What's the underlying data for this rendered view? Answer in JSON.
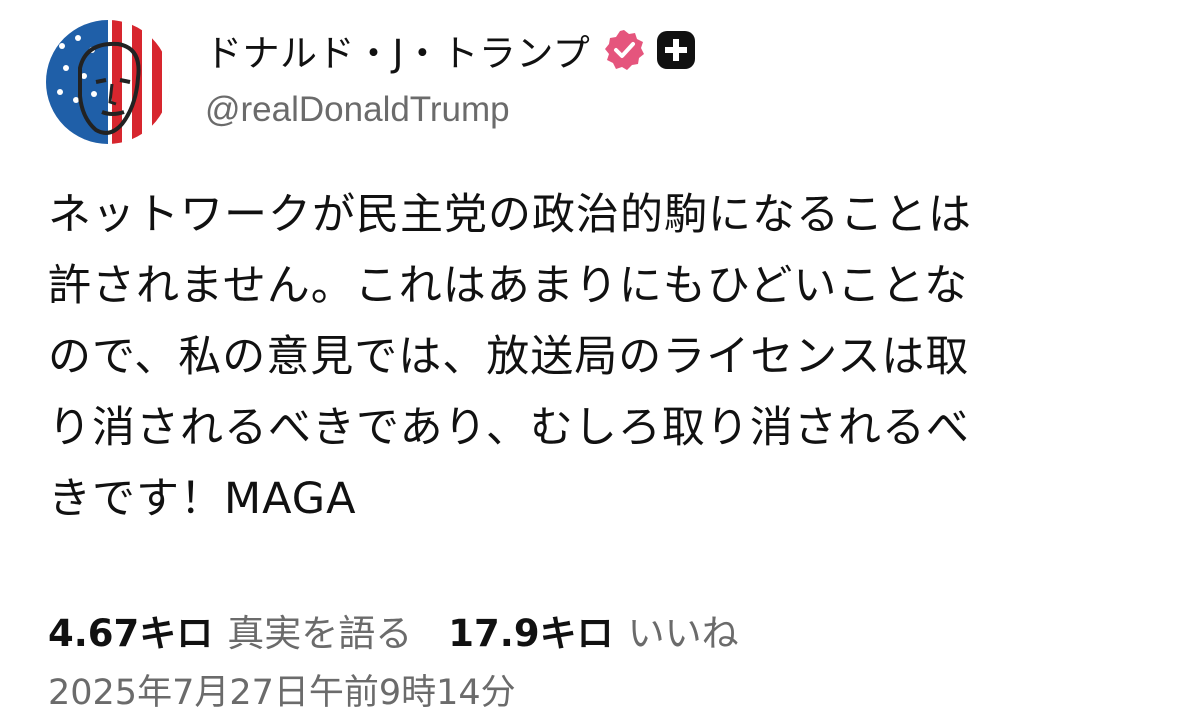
{
  "post": {
    "author": {
      "display_name": "ドナルド・J・トランプ",
      "handle": "@realDonaldTrump",
      "avatar": "avatar-image",
      "verified_icon": "verified-badge-icon",
      "platform_icon": "plus-badge-icon"
    },
    "body_lines": [
      "ネットワークが民主党の政治的駒になることは",
      "許されません。これはあまりにもひどいことな",
      "ので、私の意見では、放送局のライセンスは取",
      "り消されるべきであり、むしろ取り消されるべ",
      "きです！MAGA"
    ],
    "stats": {
      "retruths_count": "4.67キロ",
      "retruths_label": "真実を語る",
      "likes_count": "17.9キロ",
      "likes_label": "いいね"
    },
    "timestamp": "2025年7月27日午前9時14分"
  },
  "colors": {
    "text_primary": "#111111",
    "text_secondary": "#6b6b6b",
    "verified_badge": "#e5557d",
    "platform_badge": "#111111",
    "background": "#ffffff"
  }
}
